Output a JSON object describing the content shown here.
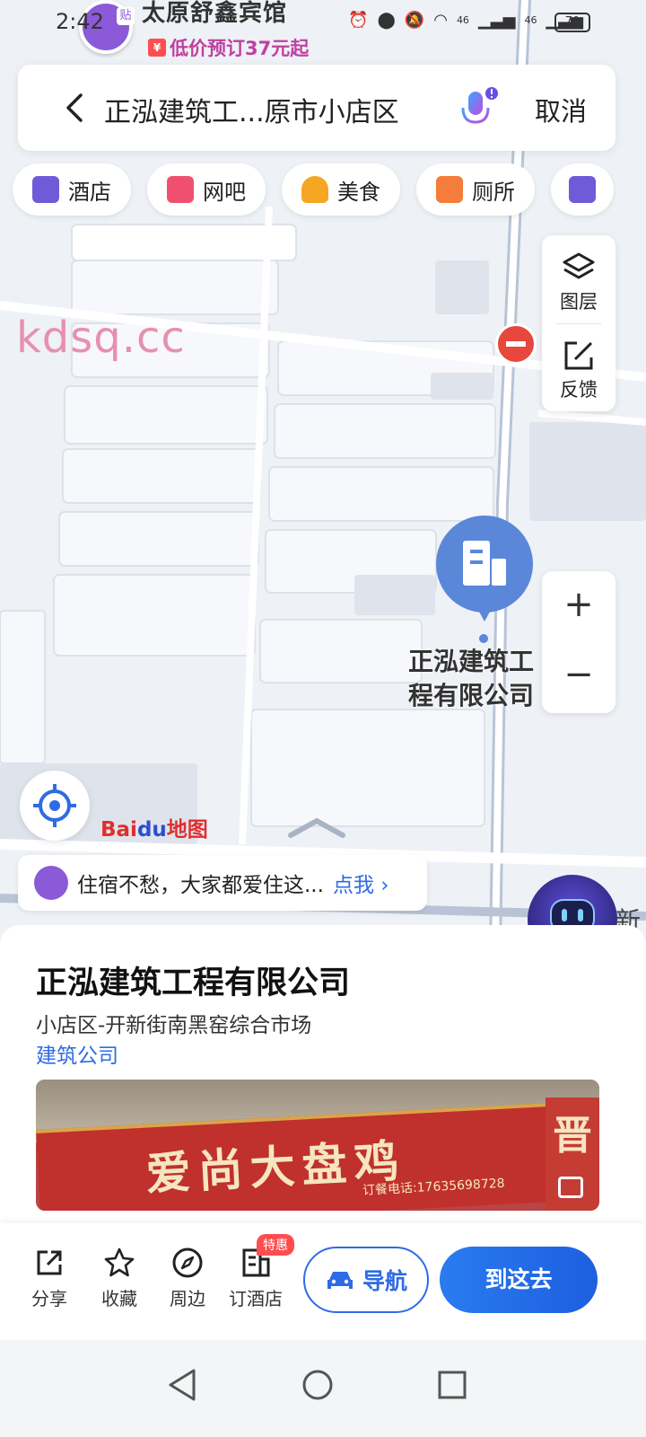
{
  "status_bar": {
    "time": "2:42",
    "network_a": "46",
    "network_b": "46",
    "battery": "70"
  },
  "map_overlay": {
    "hotel_name": "太原舒鑫宾馆",
    "hotel_tag": "贴",
    "hotel_promo_icon": "¥",
    "hotel_promo": "低价预订37元起",
    "watermark": "kdsq.cc",
    "poi_label": "正泓建筑工程有限公司",
    "baidu_logo_a": "Bai",
    "baidu_logo_b": "du",
    "baidu_logo_c": "地图",
    "right_fragment": "新"
  },
  "search": {
    "query": "正泓建筑工...原市小店区",
    "cancel_label": "取消"
  },
  "chips": [
    {
      "label": "酒店",
      "icon": "hotel-icon",
      "color": "#6f5bd8"
    },
    {
      "label": "网吧",
      "icon": "internet-cafe-icon",
      "color": "#f0506e"
    },
    {
      "label": "美食",
      "icon": "food-icon",
      "color": "#f5a623"
    },
    {
      "label": "厕所",
      "icon": "toilet-icon",
      "color": "#f57c3a"
    }
  ],
  "map_tools": {
    "layers_label": "图层",
    "feedback_label": "反馈",
    "zoom_in": "+",
    "zoom_out": "−"
  },
  "promo_banner": {
    "text": "住宿不愁，大家都爱住这...",
    "link": "点我 ›"
  },
  "place": {
    "name": "正泓建筑工程有限公司",
    "address": "小店区-开新街南黑窑综合市场",
    "category": "建筑公司",
    "photo_sign": "爱尚大盘鸡",
    "photo_phone": "订餐电话:17635698728",
    "photo_sign_right": "晋"
  },
  "actions": {
    "share": "分享",
    "favorite": "收藏",
    "nearby": "周边",
    "book_hotel": "订酒店",
    "book_badge": "特惠",
    "navigate": "导航",
    "go_here": "到这去"
  },
  "colors": {
    "accent": "#2e6be6",
    "marker": "#5b87d9",
    "alert": "#e7473c"
  }
}
